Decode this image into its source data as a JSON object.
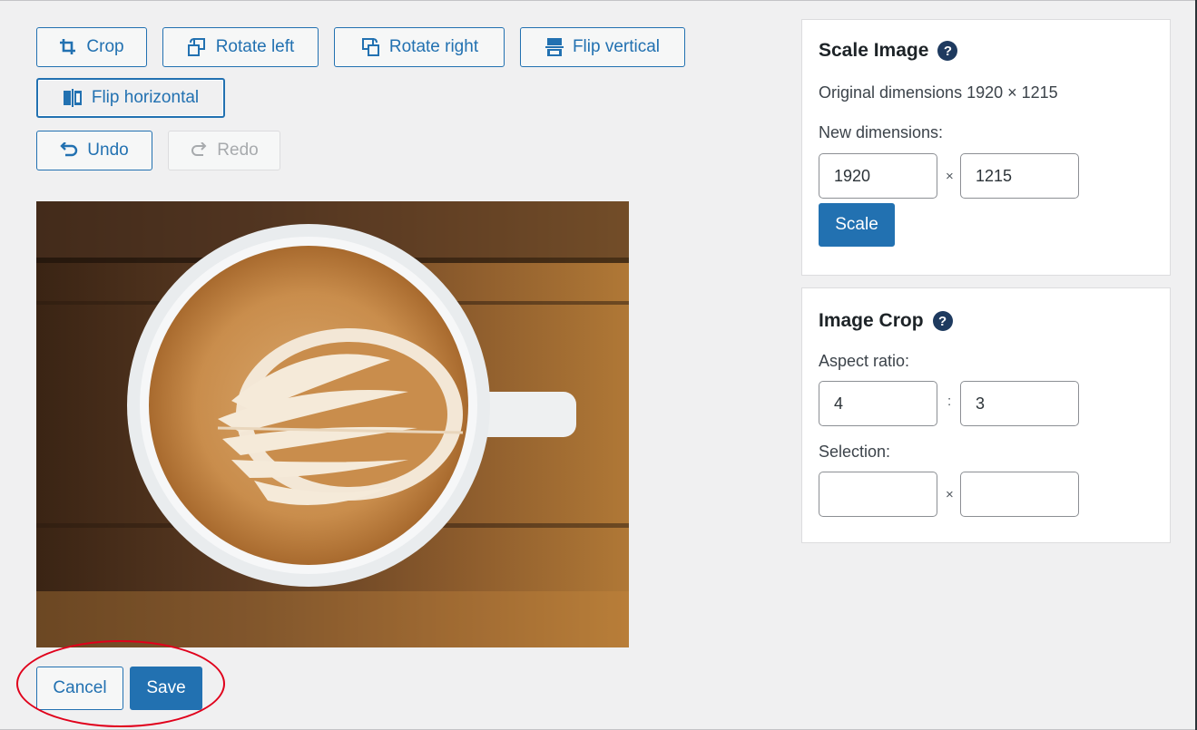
{
  "toolbar": {
    "crop": "Crop",
    "rotate_left": "Rotate left",
    "rotate_right": "Rotate right",
    "flip_vertical": "Flip vertical",
    "flip_horizontal": "Flip horizontal",
    "undo": "Undo",
    "redo": "Redo"
  },
  "scale_panel": {
    "title": "Scale Image",
    "original_dimensions": "Original dimensions 1920 × 1215",
    "new_dimensions_label": "New dimensions:",
    "width_value": "1920",
    "height_value": "1215",
    "separator": "×",
    "scale_button": "Scale"
  },
  "crop_panel": {
    "title": "Image Crop",
    "aspect_ratio_label": "Aspect ratio:",
    "aspect_w": "4",
    "aspect_h": "3",
    "aspect_separator": ":",
    "selection_label": "Selection:",
    "selection_w": "",
    "selection_h": "",
    "selection_separator": "×"
  },
  "help_glyph": "?",
  "actions": {
    "cancel": "Cancel",
    "save": "Save"
  },
  "colors": {
    "accent": "#2271b1",
    "background": "#f0f0f1",
    "highlight_ring": "#e0001b"
  }
}
